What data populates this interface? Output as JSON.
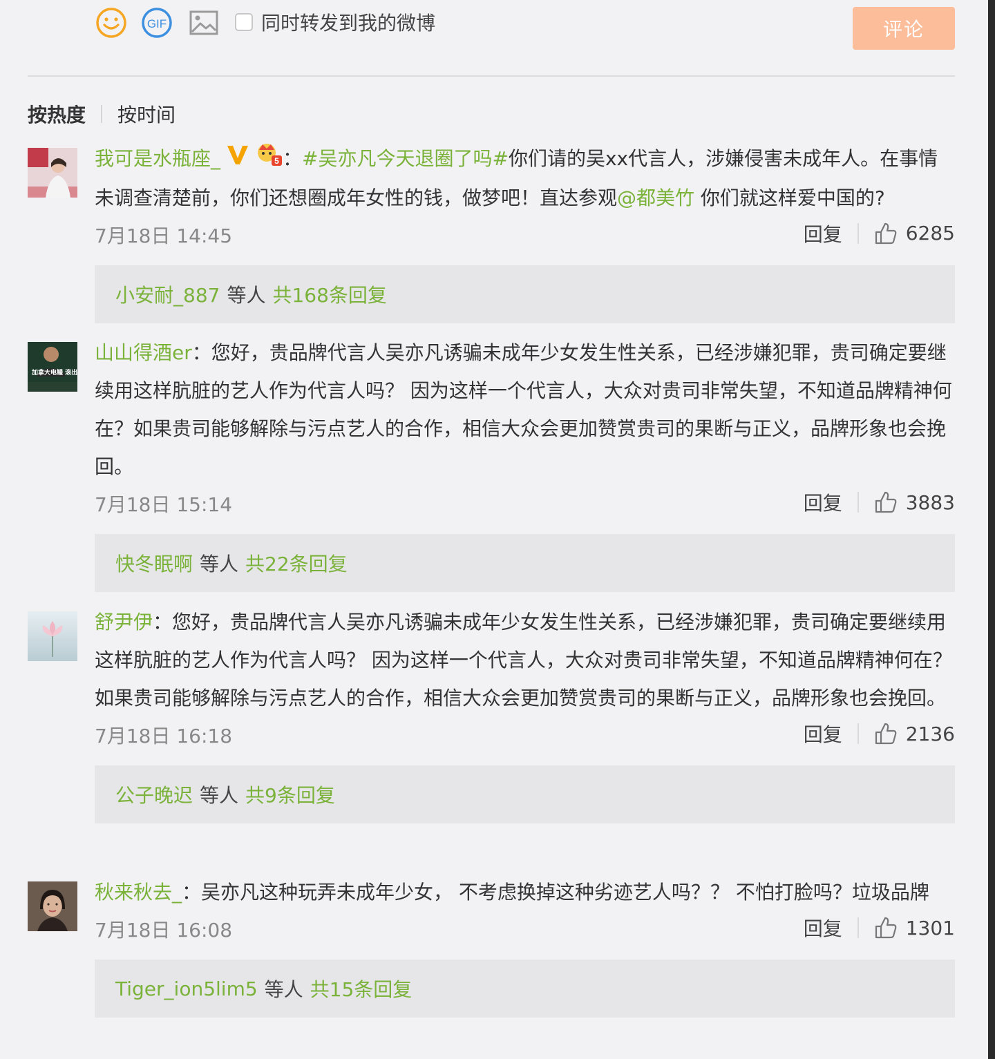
{
  "toolbar": {
    "icons": [
      "emoji-icon",
      "gif-icon",
      "image-icon"
    ],
    "gif_text": "GIF",
    "forward_label": "同时转发到我的微博",
    "forward_checked": false,
    "comment_button": "评论"
  },
  "sort": {
    "hot": "按热度",
    "time": "按时间",
    "active": "hot"
  },
  "colors": {
    "accent_green": "#7bb23a",
    "button_orange": "#fbbd9a",
    "background": "#f2f2f5",
    "reply_box": "#e6e6e9"
  },
  "comments": [
    {
      "user": "我可是水瓶座_",
      "badges": [
        "v-badge-icon",
        "crown-level-icon"
      ],
      "crown_level": "5",
      "colon": "：",
      "topic": "#吴亦凡今天退圈了吗#",
      "text_before_mention": "你们请的吴xx代言人，涉嫌侵害未成年人。在事情未调查清楚前，你们还想圈成年女性的钱，做梦吧！直达参观",
      "mention": "@都美竹",
      "text_after_mention": " 你们就这样爱中国的?",
      "time": "7月18日 14:45",
      "reply_label": "回复",
      "likes": "6285",
      "replies": {
        "first_user": "小安耐_887",
        "mid": "等人",
        "total": "共168条回复"
      }
    },
    {
      "user": "山山得酒er",
      "colon": "：",
      "text": "您好，贵品牌代言人吴亦凡诱骗未成年少女发生性关系，已经涉嫌犯罪，贵司确定要继续用这样肮脏的艺人作为代言人吗？ 因为这样一个代言人，大众对贵司非常失望，不知道品牌精神何在？如果贵司能够解除与污点艺人的合作，相信大众会更加赞赏贵司的果断与正义，品牌形象也会挽回。",
      "avatar_text": "加拿大电鳗 滚出 中国",
      "time": "7月18日 15:14",
      "reply_label": "回复",
      "likes": "3883",
      "replies": {
        "first_user": "快冬眠啊",
        "mid": "等人",
        "total": "共22条回复"
      }
    },
    {
      "user": "舒尹伊",
      "colon": "：",
      "text": "您好，贵品牌代言人吴亦凡诱骗未成年少女发生性关系，已经涉嫌犯罪，贵司确定要继续用这样肮脏的艺人作为代言人吗？ 因为这样一个代言人，大众对贵司非常失望，不知道品牌精神何在？如果贵司能够解除与污点艺人的合作，相信大众会更加赞赏贵司的果断与正义，品牌形象也会挽回。",
      "time": "7月18日 16:18",
      "reply_label": "回复",
      "likes": "2136",
      "replies": {
        "first_user": "公子晚迟",
        "mid": "等人",
        "total": "共9条回复"
      }
    },
    {
      "user": "秋来秋去_",
      "colon": "：",
      "text": "吴亦凡这种玩弄未成年少女， 不考虑换掉这种劣迹艺人吗？？  不怕打脸吗？垃圾品牌",
      "time": "7月18日 16:08",
      "reply_label": "回复",
      "likes": "1301",
      "replies": {
        "first_user": "Tiger_ion5lim5",
        "mid": "等人",
        "total": "共15条回复"
      }
    }
  ]
}
